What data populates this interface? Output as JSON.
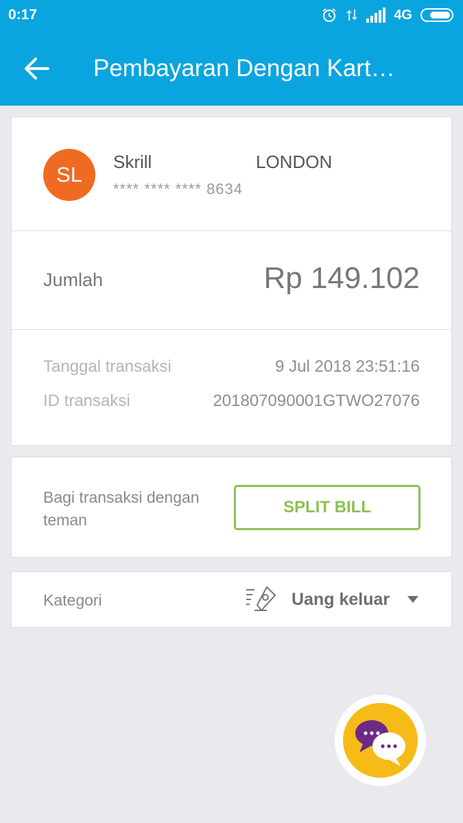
{
  "status_bar": {
    "time": "0:17",
    "network": "4G",
    "icons": [
      "alarm-icon",
      "data-transfer-icon",
      "signal-icon",
      "battery-icon"
    ]
  },
  "app_bar": {
    "title": "Pembayaran Dengan Kart…",
    "back_icon": "arrow-left-icon"
  },
  "merchant": {
    "initials": "SL",
    "name": "Skrill",
    "city": "LONDON",
    "card_number": "**** **** **** 8634",
    "avatar_color": "#f06b22"
  },
  "amount": {
    "label": "Jumlah",
    "value": "Rp 149.102"
  },
  "details": {
    "date_label": "Tanggal transaksi",
    "date_value": "9 Jul 2018 23:51:16",
    "id_label": "ID transaksi",
    "id_value": "201807090001GTWO27076"
  },
  "split": {
    "text": "Bagi transaksi dengan teman",
    "button_label": "SPLIT BILL",
    "button_color": "#8cc052"
  },
  "category": {
    "label": "Kategori",
    "value": "Uang keluar",
    "icon": "money-out-icon"
  },
  "chat_fab": {
    "icon": "chat-bubbles-icon",
    "color": "#f6bb17"
  },
  "colors": {
    "primary": "#0aa5de",
    "background": "#e9e9ee"
  }
}
